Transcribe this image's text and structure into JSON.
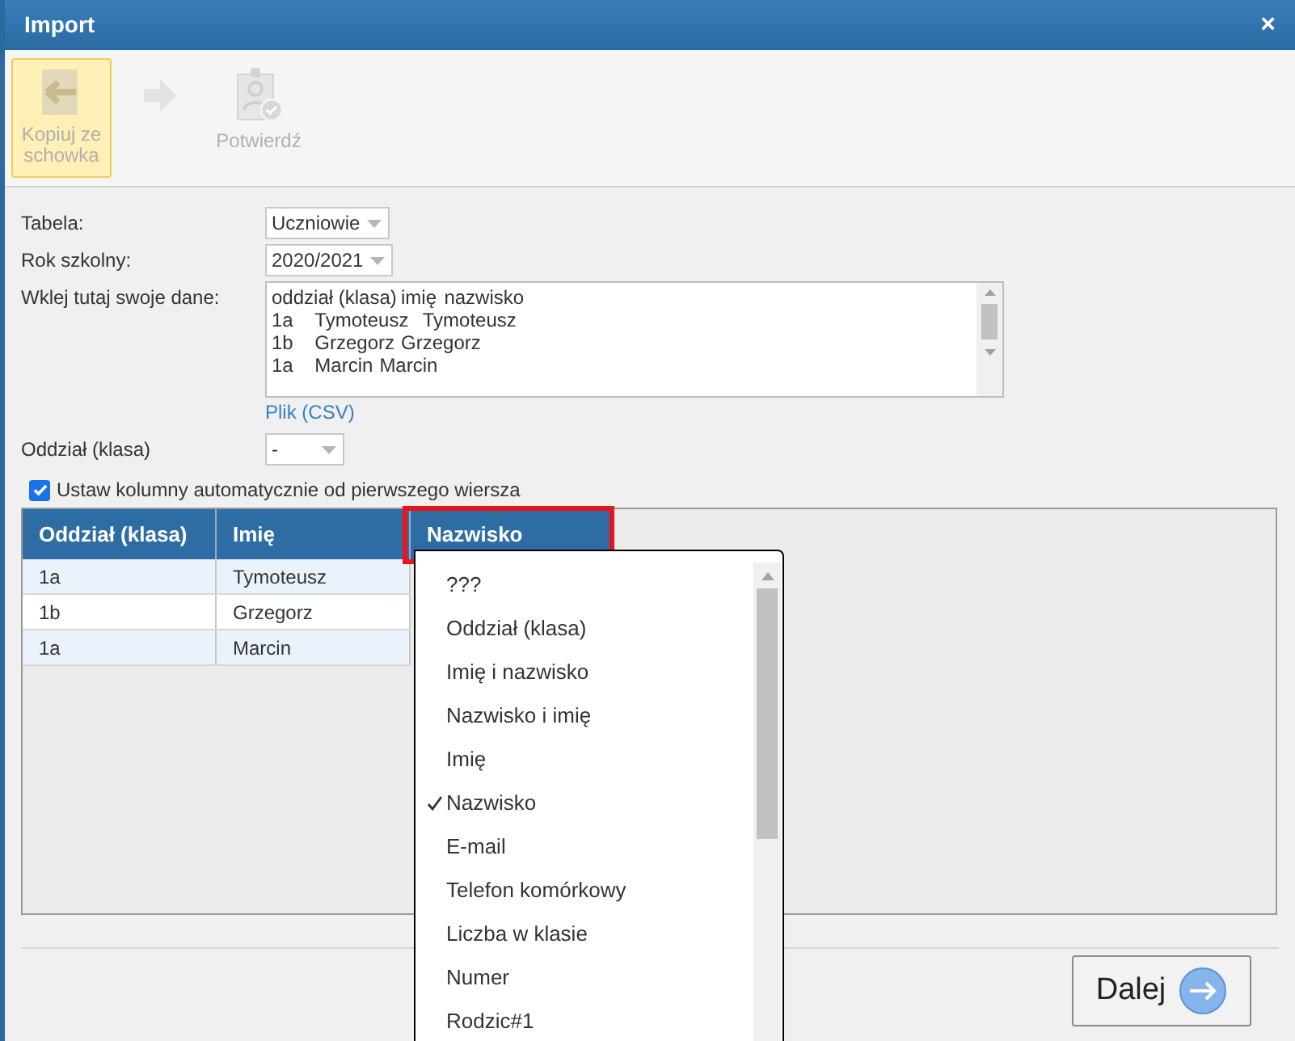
{
  "window": {
    "title": "Import",
    "close": "×"
  },
  "toolbar": [
    {
      "kind": "button",
      "label": "Kopiuj ze schowka",
      "highlighted": true
    },
    {
      "kind": "arrow",
      "highlighted": false
    },
    {
      "kind": "button",
      "label": "Potwierdź",
      "highlighted": false
    }
  ],
  "form": {
    "table_label": "Tabela:",
    "table_value": "Uczniowie",
    "year_label": "Rok szkolny:",
    "year_value": "2020/2021",
    "paste_label": "Wklej tutaj swoje dane:",
    "paste_lines": [
      "oddział (klasa)\timię\tnazwisko",
      "1a\tTymoteusz\tTymoteusz",
      "1b\tGrzegorz\tGrzegorz",
      "1a\tMarcin\tMarcin"
    ],
    "file_link": "Plik (CSV)",
    "class_label": "Oddział (klasa)",
    "class_value": "-"
  },
  "auto_columns": {
    "label": "Ustaw kolumny automatycznie od pierwszego wiersza",
    "checked": true
  },
  "table": {
    "columns": [
      {
        "label": "Oddział (klasa)",
        "highlighted": false
      },
      {
        "label": "Imię",
        "highlighted": false
      },
      {
        "label": "Nazwisko",
        "highlighted": true
      }
    ],
    "rows": [
      [
        "1a",
        "Tymoteusz"
      ],
      [
        "1b",
        "Grzegorz"
      ],
      [
        "1a",
        "Marcin"
      ]
    ]
  },
  "column_menu": [
    {
      "label": "???",
      "selected": false
    },
    {
      "label": "Oddział (klasa)",
      "selected": false
    },
    {
      "label": "Imię i nazwisko",
      "selected": false
    },
    {
      "label": "Nazwisko i imię",
      "selected": false
    },
    {
      "label": "Imię",
      "selected": false
    },
    {
      "label": "Nazwisko",
      "selected": true
    },
    {
      "label": "E-mail",
      "selected": false
    },
    {
      "label": "Telefon komórkowy",
      "selected": false
    },
    {
      "label": "Liczba w klasie",
      "selected": false
    },
    {
      "label": "Numer",
      "selected": false
    },
    {
      "label": "Rodzic#1",
      "selected": false
    }
  ],
  "next_button": {
    "label": "Dalej"
  }
}
